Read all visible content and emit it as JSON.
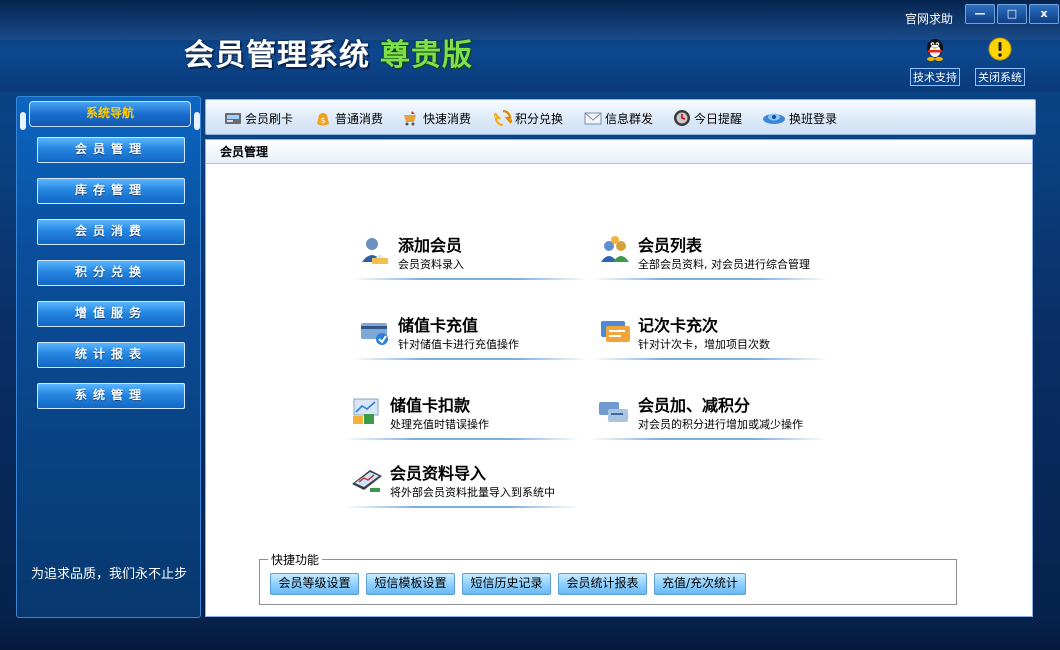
{
  "window": {
    "title_main": "会员管理系统",
    "title_edition": "尊贵版",
    "help_link": "官网求助",
    "btn_minimize": "—",
    "btn_maximize": "□",
    "btn_close": "x"
  },
  "top_tools": [
    {
      "label": "技术支持",
      "icon": "qq-penguin-icon"
    },
    {
      "label": "关闭系统",
      "icon": "warning-icon"
    }
  ],
  "sidebar": {
    "header": "系统导航",
    "items": [
      "会员管理",
      "库存管理",
      "会员消费",
      "积分兑换",
      "增值服务",
      "统计报表",
      "系统管理"
    ],
    "slogan": "为追求品质，我们永不止步"
  },
  "toolbar": {
    "items": [
      {
        "label": "会员刷卡",
        "icon": "card-reader-icon"
      },
      {
        "label": "普通消费",
        "icon": "money-bag-icon"
      },
      {
        "label": "快速消费",
        "icon": "fast-shopping-icon"
      },
      {
        "label": "积分兑换",
        "icon": "exchange-arrows-icon"
      },
      {
        "label": "信息群发",
        "icon": "envelope-icon"
      },
      {
        "label": "今日提醒",
        "icon": "clock-icon"
      },
      {
        "label": "换班登录",
        "icon": "shift-login-icon"
      }
    ]
  },
  "content": {
    "section_title": "会员管理",
    "functions": [
      {
        "title": "添加会员",
        "desc": "会员资料录入",
        "icon": "add-member-icon"
      },
      {
        "title": "会员列表",
        "desc": "全部会员资料, 对会员进行综合管理",
        "icon": "member-list-icon"
      },
      {
        "title": "储值卡充值",
        "desc": "针对储值卡进行充值操作",
        "icon": "card-recharge-icon"
      },
      {
        "title": "记次卡充次",
        "desc": "针对计次卡，增加项目次数",
        "icon": "count-card-icon"
      },
      {
        "title": "储值卡扣款",
        "desc": "处理充值时错误操作",
        "icon": "card-deduct-icon"
      },
      {
        "title": "会员加、减积分",
        "desc": "对会员的积分进行增加或减少操作",
        "icon": "points-adjust-icon"
      },
      {
        "title": "会员资料导入",
        "desc": "将外部会员资料批量导入到系统中",
        "icon": "data-import-icon"
      }
    ],
    "quick": {
      "legend": "快捷功能",
      "buttons": [
        "会员等级设置",
        "短信模板设置",
        "短信历史记录",
        "会员统计报表",
        "充值/充次统计"
      ]
    }
  },
  "colors": {
    "edition_green": "#7ee04a",
    "nav_header_text": "#ffcc00"
  }
}
